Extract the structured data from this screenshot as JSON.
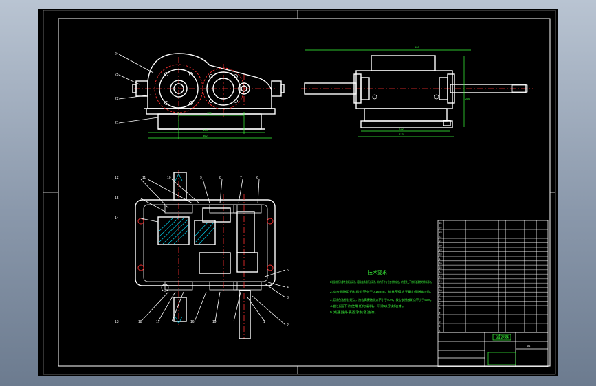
{
  "drawing": {
    "type": "gear reducer assembly drawing",
    "background_color": "#000000",
    "line_color": "#ffffff",
    "dimension_color": "#3cff3c",
    "centerline_color": "#ff3030",
    "hatch_color": "#00e0ff"
  },
  "front_view": {
    "leaders": [
      "24",
      "25",
      "22",
      "21"
    ],
    "dims": [
      "155",
      "193",
      "362"
    ]
  },
  "side_view": {
    "dims": [
      "600",
      "256",
      "232",
      "213"
    ]
  },
  "plan_view": {
    "leaders": [
      "12",
      "11",
      "10",
      "9",
      "8",
      "7",
      "6",
      "15",
      "14",
      "13",
      "18",
      "17",
      "16",
      "19",
      "5",
      "4",
      "3",
      "2",
      "1"
    ]
  },
  "notes": {
    "title": "技术要求",
    "lines": [
      "1.装配前所有零件用煤油清洗，滚动轴承用汽油清洗，机内不许有任何杂物存在。内壁涂上不被机油浸蚀的涂料两次。",
      "2.啮合侧隙用铅丝检验不小于0.16mm，铅丝不得大于最小侧隙的4倍。",
      "3.用涂色法检验斑点，按齿高接触斑点不小于40%，按齿长接触斑点不小于50%。",
      "4.剖分面不许使用任何填料，可涂以密封油漆。",
      "5.减速器外表面涂灰色油漆。"
    ]
  },
  "title_block": {
    "name": "减速器",
    "drawing_no": "A1"
  },
  "parts_list": {
    "rows": [
      "25",
      "24",
      "23",
      "22",
      "21",
      "20",
      "19",
      "18",
      "17",
      "16",
      "15",
      "14",
      "13",
      "12",
      "11",
      "10",
      "9",
      "8",
      "7",
      "6",
      "5",
      "4",
      "3",
      "2",
      "1"
    ]
  }
}
